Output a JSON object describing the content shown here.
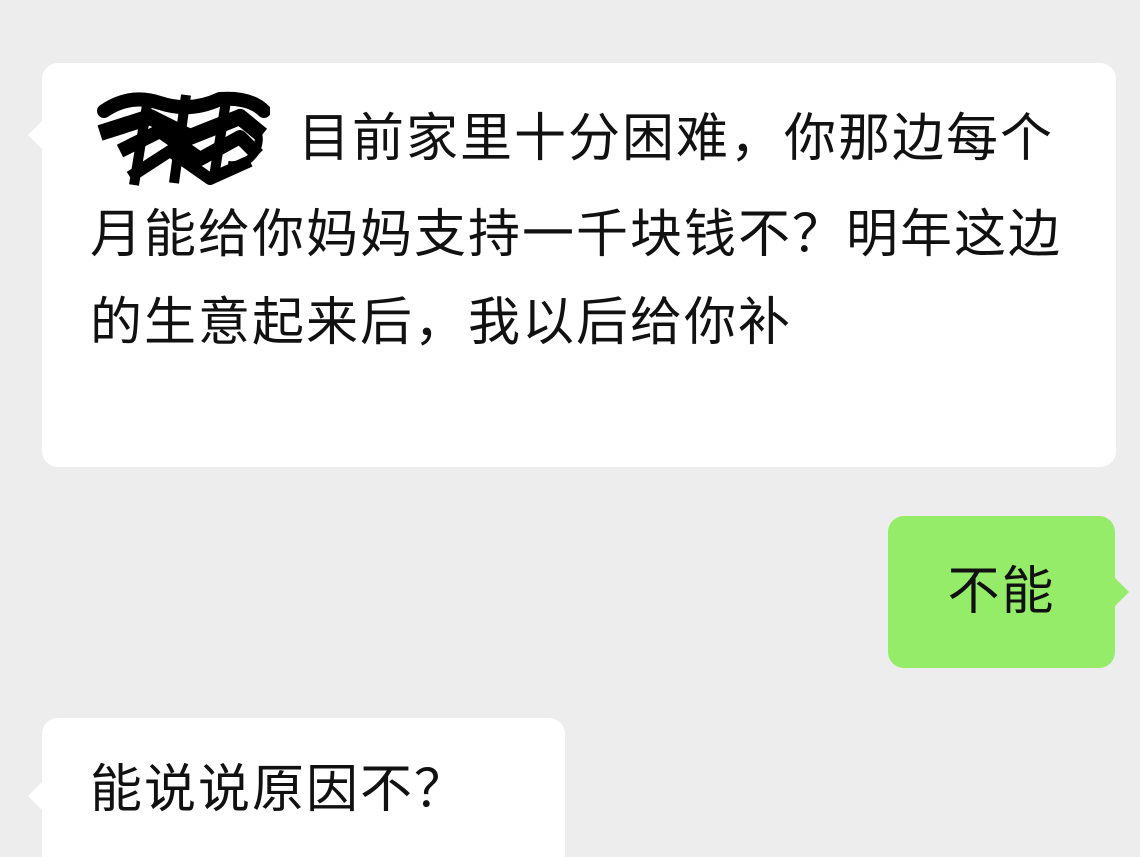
{
  "messages": [
    {
      "sender": "received",
      "text": "目前家里十分困难，你那边每个月能给你妈妈支持一千块钱不？明年这边的生意起来后，我以后给你补"
    },
    {
      "sender": "sent",
      "text": "不能"
    },
    {
      "sender": "received",
      "text": "能说说原因不？"
    }
  ],
  "colors": {
    "background": "#ededed",
    "received_bubble": "#ffffff",
    "sent_bubble": "#95ec69",
    "text": "#111111"
  }
}
